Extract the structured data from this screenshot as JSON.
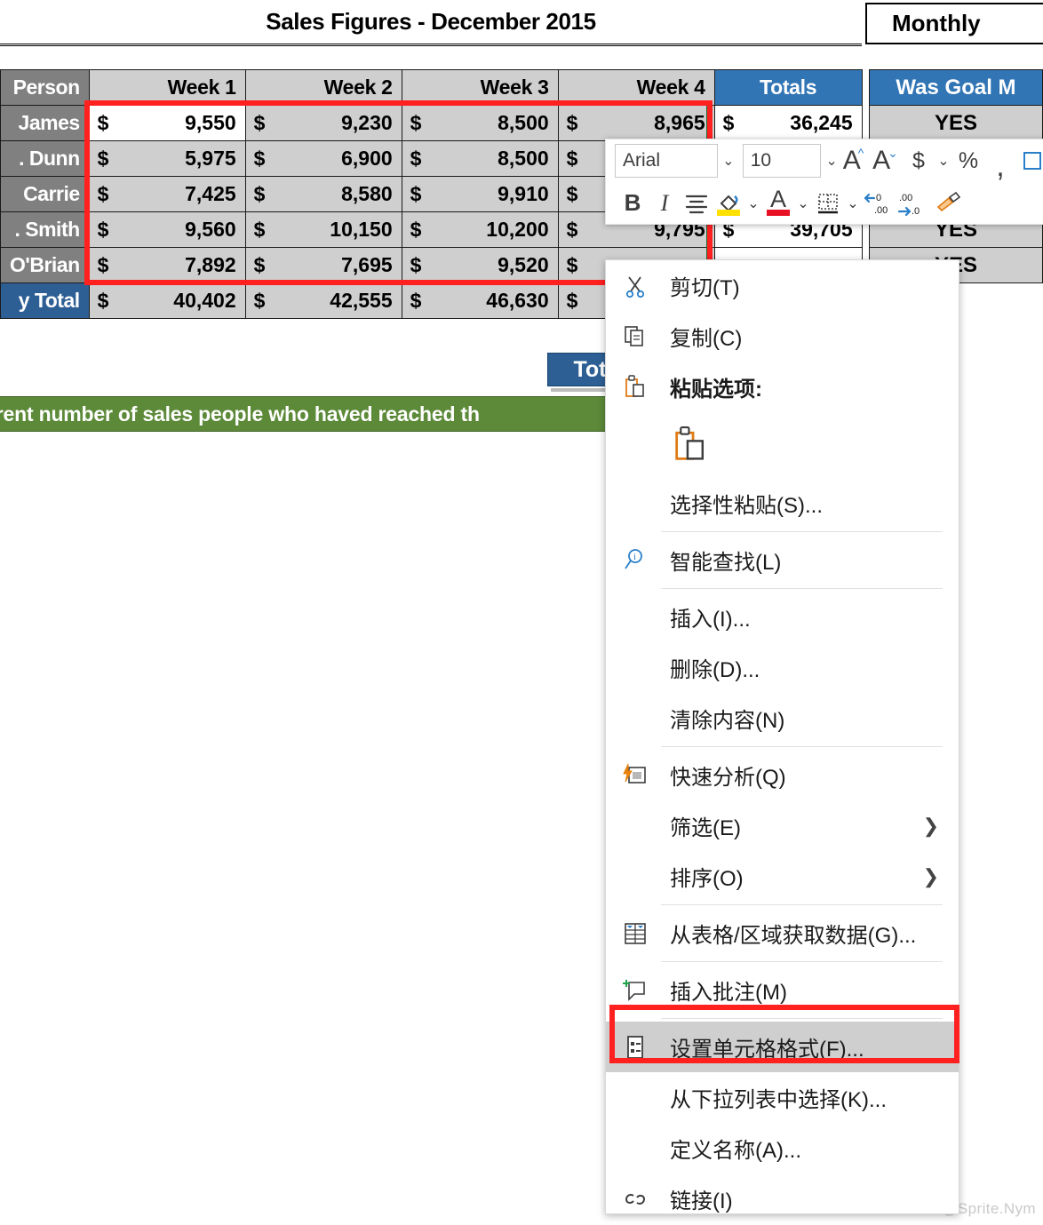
{
  "header": {
    "title": "Sales Figures - December 2015",
    "secondary_title": "Monthly"
  },
  "table": {
    "columns": [
      "Person",
      "Week 1",
      "Week 2",
      "Week 3",
      "Week 4",
      "Totals"
    ],
    "currency_symbol": "$",
    "rows": [
      {
        "label": "James",
        "week1": "9,550",
        "week2": "9,230",
        "week3": "8,500",
        "week4": "8,965",
        "total": "36,245"
      },
      {
        "label": ". Dunn",
        "week1": "5,975",
        "week2": "6,900",
        "week3": "8,500",
        "week4": "",
        "total": ""
      },
      {
        "label": "Carrie",
        "week1": "7,425",
        "week2": "8,580",
        "week3": "9,910",
        "week4": "",
        "total": ""
      },
      {
        "label": ". Smith",
        "week1": "9,560",
        "week2": "10,150",
        "week3": "10,200",
        "week4": "9,795",
        "total": "39,705"
      },
      {
        "label": "O'Brian",
        "week1": "7,892",
        "week2": "7,695",
        "week3": "9,520",
        "week4": "",
        "total": ""
      }
    ],
    "footer": {
      "label": "y Total",
      "week1": "40,402",
      "week2": "42,555",
      "week3": "46,630",
      "week4": "",
      "total": ""
    }
  },
  "goal_table": {
    "header": "Was Goal M",
    "values": [
      "YES",
      "",
      "",
      "YES",
      "YES"
    ]
  },
  "tot_tag": {
    "label": "Tot"
  },
  "banner": {
    "text": "rrent number of sales people who haved reached th"
  },
  "mini_toolbar": {
    "font_name": "Arial",
    "font_size": "10",
    "buttons": {
      "grow_font": "A",
      "shrink_font": "A",
      "accounting": "$",
      "percent": "%",
      "comma": ",",
      "bold": "B",
      "italic": "I",
      "center": "center-align",
      "fill_color": "fill",
      "font_color": "font-color",
      "borders": "borders",
      "decrease_decimal": ".00",
      "increase_decimal": ".00",
      "format_painter": "painter"
    }
  },
  "context_menu": {
    "items": [
      {
        "id": "cut",
        "label": "剪切(T)",
        "icon": "scissors-icon",
        "type": "item"
      },
      {
        "id": "copy",
        "label": "复制(C)",
        "icon": "copy-icon",
        "type": "item"
      },
      {
        "id": "paste-options",
        "label": "粘贴选项:",
        "icon": "clipboard-icon",
        "type": "header"
      },
      {
        "id": "paste-gallery",
        "label": "",
        "icon": "clipboard-icon",
        "type": "gallery"
      },
      {
        "id": "paste-special",
        "label": "选择性粘贴(S)...",
        "icon": "",
        "type": "item"
      },
      {
        "id": "smart-lookup",
        "label": "智能查找(L)",
        "icon": "magnifier-icon",
        "type": "item"
      },
      {
        "id": "insert",
        "label": "插入(I)...",
        "icon": "",
        "type": "item"
      },
      {
        "id": "delete",
        "label": "删除(D)...",
        "icon": "",
        "type": "item"
      },
      {
        "id": "clear",
        "label": "清除内容(N)",
        "icon": "",
        "type": "item"
      },
      {
        "id": "quick-analysis",
        "label": "快速分析(Q)",
        "icon": "lightning-icon",
        "type": "item"
      },
      {
        "id": "filter",
        "label": "筛选(E)",
        "icon": "",
        "type": "submenu"
      },
      {
        "id": "sort",
        "label": "排序(O)",
        "icon": "",
        "type": "submenu"
      },
      {
        "id": "get-data",
        "label": "从表格/区域获取数据(G)...",
        "icon": "table-icon",
        "type": "item"
      },
      {
        "id": "insert-comment",
        "label": "插入批注(M)",
        "icon": "comment-icon",
        "type": "item"
      },
      {
        "id": "format-cells",
        "label": "设置单元格格式(F)...",
        "icon": "format-cells-icon",
        "type": "item",
        "selected": true
      },
      {
        "id": "pick-list",
        "label": "从下拉列表中选择(K)...",
        "icon": "",
        "type": "item"
      },
      {
        "id": "define-name",
        "label": "定义名称(A)...",
        "icon": "",
        "type": "item"
      },
      {
        "id": "link",
        "label": "链接(I)",
        "icon": "link-icon",
        "type": "item"
      }
    ]
  },
  "watermark": {
    "text": "CSDN @Sprite.Nym"
  },
  "colors": {
    "header_blue": "#3175B5",
    "total_blue": "#2E5F94",
    "row_label_gray": "#808080",
    "cell_gray": "#cfcfcf",
    "banner_green": "#5C8A39",
    "annotation_red": "#FF2020",
    "selection_green": "#1E6B3A"
  }
}
